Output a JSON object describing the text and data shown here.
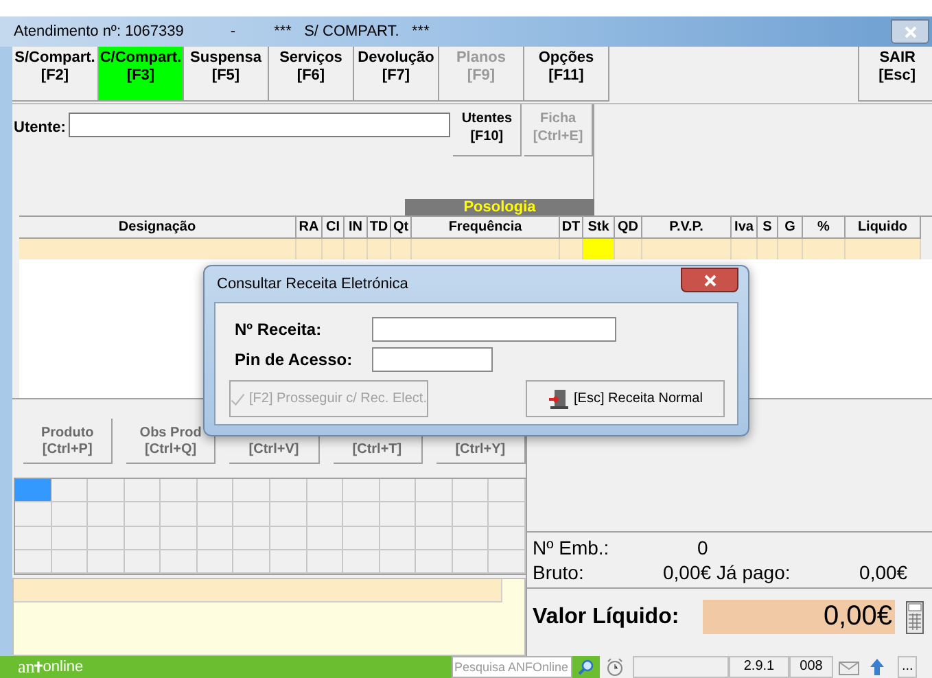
{
  "window": {
    "title": "Atendimento nº: 1067339",
    "separator": "-",
    "title_mode": "***   S/ COMPART.   ***"
  },
  "toolbar": [
    {
      "label": "S/Compart.",
      "key": "[F2]",
      "selected": false,
      "disabled": false
    },
    {
      "label": "C/Compart.",
      "key": "[F3]",
      "selected": true,
      "disabled": false
    },
    {
      "label": "Suspensa",
      "key": "[F5]",
      "selected": false,
      "disabled": false
    },
    {
      "label": "Serviços",
      "key": "[F6]",
      "selected": false,
      "disabled": false
    },
    {
      "label": "Devolução",
      "key": "[F7]",
      "selected": false,
      "disabled": false
    },
    {
      "label": "Planos",
      "key": "[F9]",
      "selected": false,
      "disabled": true
    },
    {
      "label": "Opções",
      "key": "[F11]",
      "selected": false,
      "disabled": false
    }
  ],
  "exit_button": {
    "label": "SAIR",
    "key": "[Esc]"
  },
  "utente": {
    "label": "Utente:",
    "buttons": [
      {
        "label": "Utentes",
        "key": "[F10]",
        "disabled": false
      },
      {
        "label": "Ficha",
        "key": "[Ctrl+E]",
        "disabled": true
      }
    ]
  },
  "posologia_label": "Posologia",
  "table": {
    "columns": [
      {
        "label": "Designação",
        "highlighted": false
      },
      {
        "label": "RA",
        "highlighted": false
      },
      {
        "label": "CI",
        "highlighted": false
      },
      {
        "label": "IN",
        "highlighted": false
      },
      {
        "label": "TD",
        "highlighted": false
      },
      {
        "label": "Qt",
        "highlighted": false
      },
      {
        "label": "Frequência",
        "highlighted": false
      },
      {
        "label": "DT",
        "highlighted": false
      },
      {
        "label": "Stk",
        "highlighted": true
      },
      {
        "label": "QD",
        "highlighted": false
      },
      {
        "label": "P.V.P.",
        "highlighted": false
      },
      {
        "label": "Iva",
        "highlighted": false
      },
      {
        "label": "S",
        "highlighted": false
      },
      {
        "label": "G",
        "highlighted": false
      },
      {
        "label": "%",
        "highlighted": false
      },
      {
        "label": "Liquido",
        "highlighted": false
      }
    ]
  },
  "product_buttons": [
    {
      "label": "Produto",
      "key": "[Ctrl+P]"
    },
    {
      "label": "Obs Prod",
      "key": "[Ctrl+Q]"
    },
    {
      "key": "[Ctrl+V]"
    },
    {
      "key": "[Ctrl+T]"
    },
    {
      "key": "[Ctrl+Y]"
    }
  ],
  "grid": {
    "rows": [
      [
        {
          "selected": true
        },
        {
          "selected": false
        },
        {
          "selected": false
        },
        {
          "selected": false
        },
        {
          "selected": false
        },
        {
          "selected": false
        },
        {
          "selected": false
        },
        {
          "selected": false
        },
        {
          "selected": false
        },
        {
          "selected": false
        },
        {
          "selected": false
        },
        {
          "selected": false
        },
        {
          "selected": false
        },
        {
          "selected": false
        }
      ],
      [
        {
          "selected": false
        },
        {
          "selected": false
        },
        {
          "selected": false
        },
        {
          "selected": false
        },
        {
          "selected": false
        },
        {
          "selected": false
        },
        {
          "selected": false
        },
        {
          "selected": false
        },
        {
          "selected": false
        },
        {
          "selected": false
        },
        {
          "selected": false
        },
        {
          "selected": false
        },
        {
          "selected": false
        },
        {
          "selected": false
        }
      ],
      [
        {
          "selected": false
        },
        {
          "selected": false
        },
        {
          "selected": false
        },
        {
          "selected": false
        },
        {
          "selected": false
        },
        {
          "selected": false
        },
        {
          "selected": false
        },
        {
          "selected": false
        },
        {
          "selected": false
        },
        {
          "selected": false
        },
        {
          "selected": false
        },
        {
          "selected": false
        },
        {
          "selected": false
        },
        {
          "selected": false
        }
      ],
      [
        {
          "selected": false
        },
        {
          "selected": false
        },
        {
          "selected": false
        },
        {
          "selected": false
        },
        {
          "selected": false
        },
        {
          "selected": false
        },
        {
          "selected": false
        },
        {
          "selected": false
        },
        {
          "selected": false
        },
        {
          "selected": false
        },
        {
          "selected": false
        },
        {
          "selected": false
        },
        {
          "selected": false
        },
        {
          "selected": false
        }
      ]
    ]
  },
  "totals": {
    "emb_label": "Nº Emb.:",
    "emb_value": "0",
    "bruto_label": "Bruto:",
    "bruto_value": "0,00€",
    "pago_label": "Já pago:",
    "pago_value": "0,00€",
    "liquido_label": "Valor Líquido:",
    "liquido_value": "0,00€"
  },
  "status_bar": {
    "logo_left": "an",
    "logo_right": "online",
    "search_placeholder": "Pesquisa ANFOnline",
    "version": "2.9.1",
    "code": "008",
    "more": "..."
  },
  "dialog": {
    "title": "Consultar Receita Eletrónica",
    "fields": [
      {
        "label": "Nº Receita:"
      },
      {
        "label": "Pin de Acesso:"
      }
    ],
    "buttons": [
      {
        "label": "[F2] Prosseguir c/ Rec. Elect.",
        "kind": "check",
        "disabled": true
      },
      {
        "label": "[Esc] Receita Normal",
        "kind": "door",
        "disabled": false
      }
    ]
  }
}
